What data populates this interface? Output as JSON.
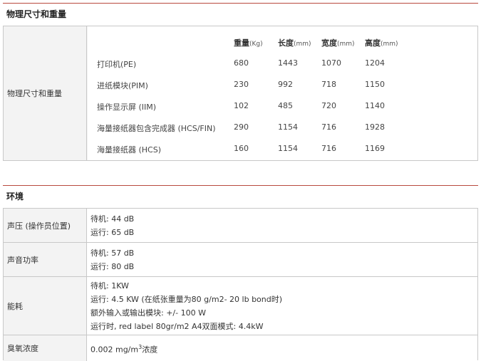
{
  "dimensions": {
    "section_title": "物理尺寸和重量",
    "row_label": "物理尺寸和重量",
    "headers": [
      {
        "label": "重量",
        "unit": "(Kg)"
      },
      {
        "label": "长度",
        "unit": "(mm)"
      },
      {
        "label": "宽度",
        "unit": "(mm)"
      },
      {
        "label": "高度",
        "unit": "(mm)"
      }
    ],
    "rows": [
      {
        "name": "打印机(PE)",
        "values": [
          "680",
          "1443",
          "1070",
          "1204"
        ]
      },
      {
        "name": "进纸模块(PIM)",
        "values": [
          "230",
          "992",
          "718",
          "1150"
        ]
      },
      {
        "name": "操作显示屏 (IIM)",
        "values": [
          "102",
          "485",
          "720",
          "1140"
        ]
      },
      {
        "name": "海量接纸器包含完成器 (HCS/FIN)",
        "values": [
          "290",
          "1154",
          "716",
          "1928"
        ]
      },
      {
        "name": "海量接纸器 (HCS)",
        "values": [
          "160",
          "1154",
          "716",
          "1169"
        ]
      }
    ]
  },
  "environment": {
    "section_title": "环境",
    "rows": [
      {
        "label": "声压 (操作员位置)",
        "lines": [
          "待机: 44 dB",
          "运行: 65 dB"
        ]
      },
      {
        "label": "声音功率",
        "lines": [
          "待机: 57 dB",
          "运行: 80 dB"
        ]
      },
      {
        "label": "能耗",
        "lines": [
          "待机: 1KW",
          "运行: 4.5 KW (在纸张重量为80 g/m2- 20 lb bond时)",
          "额外输入或输出模块: +/- 100 W",
          "运行时, red label 80gr/m2 A4双面模式: 4.4kW"
        ]
      },
      {
        "label": "臭氧浓度",
        "value_prefix": "0.002 mg/m",
        "value_sup": "3",
        "value_suffix": "浓度"
      }
    ]
  }
}
